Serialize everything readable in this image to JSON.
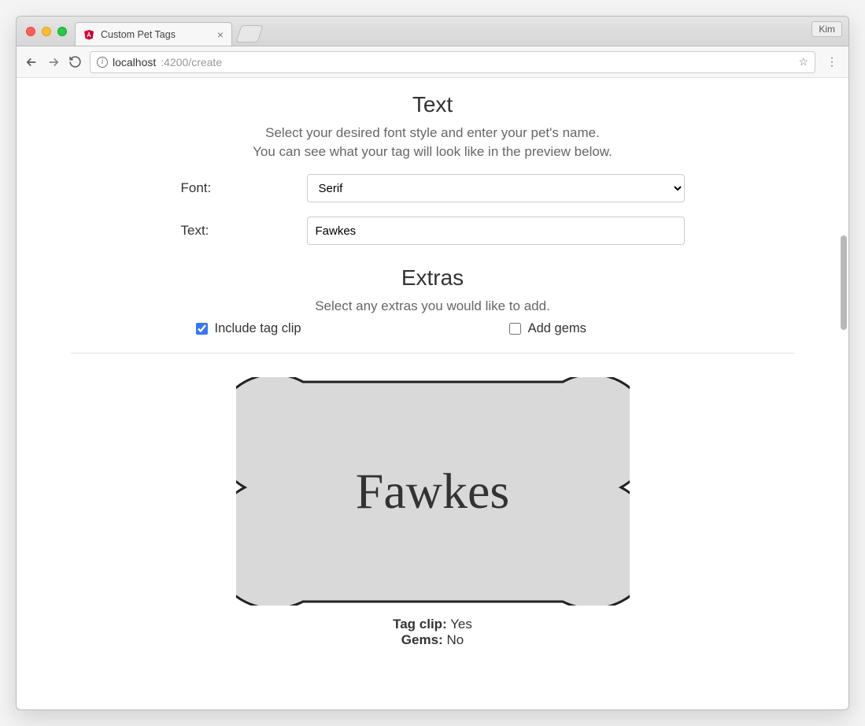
{
  "window": {
    "user_badge": "Kim"
  },
  "tab": {
    "title": "Custom Pet Tags"
  },
  "address_bar": {
    "host": "localhost",
    "rest": ":4200/create"
  },
  "sections": {
    "text": {
      "heading": "Text",
      "lead1": "Select your desired font style and enter your pet's name.",
      "lead2": "You can see what your tag will look like in the preview below.",
      "font_label": "Font:",
      "font_value": "Serif",
      "text_label": "Text:",
      "text_value": "Fawkes"
    },
    "extras": {
      "heading": "Extras",
      "lead": "Select any extras you would like to add.",
      "clip_label": "Include tag clip",
      "clip_checked": true,
      "gems_label": "Add gems",
      "gems_checked": false
    }
  },
  "preview": {
    "name": "Fawkes",
    "summary": {
      "clip_label": "Tag clip:",
      "clip_value": "Yes",
      "gems_label": "Gems:",
      "gems_value": "No"
    }
  }
}
